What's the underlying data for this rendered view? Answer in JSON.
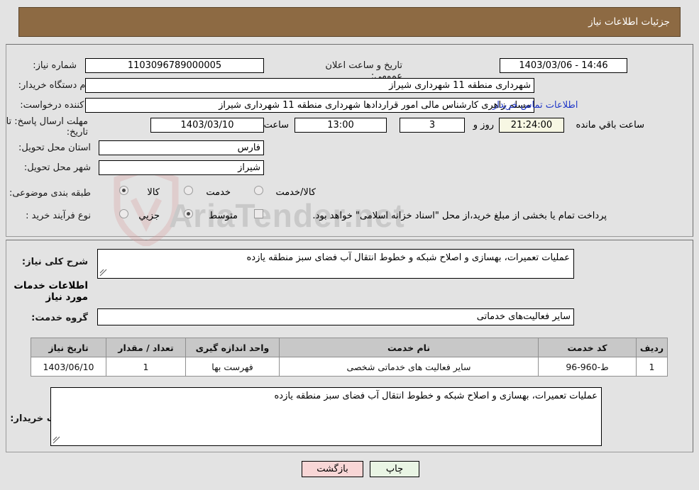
{
  "header": {
    "title": "جزئیات اطلاعات نیاز"
  },
  "watermark": {
    "text": "AriaTender.net",
    "shield_icon": "shield-icon"
  },
  "top_section": {
    "need_number": {
      "label": "شماره نیاز:",
      "value": "1103096789000005"
    },
    "announce_datetime": {
      "label": "تاریخ و ساعت اعلان عمومی:",
      "value": "14:46 - 1403/03/06"
    },
    "buyer_org": {
      "label": "نام دستگاه خریدار:",
      "value": "شهرداری منطقه 11 شهرداری شیراز"
    },
    "creator": {
      "label": "ایجاد کننده درخواست:",
      "value": "مسلم زاهری کارشناس مالی امور قراردادها شهرداری منطقه 11 شهرداری شیراز",
      "contact_link": "اطلاعات تماس خریدار"
    },
    "deadline": {
      "label": "مهلت ارسال پاسخ: تا تاریخ:",
      "date": "1403/03/10",
      "time_label": "ساعت",
      "time": "13:00",
      "days": "3",
      "days_suffix": "روز و",
      "countdown": "21:24:00",
      "countdown_suffix": "ساعت باقي مانده"
    },
    "province": {
      "label": "استان محل تحویل:",
      "value": "فارس"
    },
    "city": {
      "label": "شهر محل تحویل:",
      "value": "شیراز"
    },
    "category": {
      "label": "طبقه بندی موضوعی:",
      "options": [
        "کالا",
        "خدمت",
        "کالا/خدمت"
      ],
      "selected": "خدمت"
    },
    "purchase_type": {
      "label": "نوع فرآیند خرید :",
      "options": [
        "جزیي",
        "متوسط"
      ],
      "selected": "متوسط",
      "treasury_checkbox_label": "پرداخت تمام یا بخشی از مبلغ خرید،از محل \"اسناد خزانه اسلامی\" خواهد بود.",
      "treasury_checked": false
    }
  },
  "middle_section": {
    "general_desc": {
      "label": "شرح کلی نیاز:",
      "value": "عملیات تعمیرات، بهسازی و اصلاح شبکه و خطوط انتقال آب فضای سبز منطقه یازده"
    },
    "services_title": "اطلاعات خدمات مورد نیاز",
    "service_group": {
      "label": "گروه خدمت:",
      "value": "سایر فعالیت‌های خدماتی"
    },
    "table": {
      "columns": [
        "ردیف",
        "کد خدمت",
        "نام خدمت",
        "واحد اندازه گیری",
        "تعداد / مقدار",
        "تاریخ نیاز"
      ],
      "rows": [
        {
          "row_no": "1",
          "service_code": "ط-960-96",
          "service_name": "سایر فعالیت های خدماتی شخصی",
          "unit": "فهرست بها",
          "quantity": "1",
          "need_date": "1403/06/10"
        }
      ]
    },
    "buyer_notes": {
      "label": "توضیحات خریدار:",
      "value": "عملیات تعمیرات، بهسازی و اصلاح شبکه و خطوط انتقال آب فضای سبز منطقه یازده"
    }
  },
  "footer": {
    "print_button": "چاپ",
    "back_button": "بازگشت"
  }
}
